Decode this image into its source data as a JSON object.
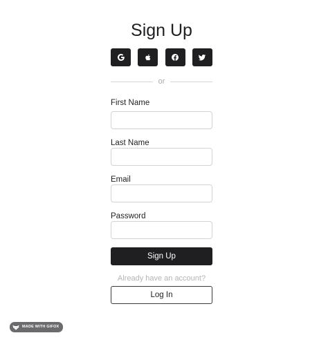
{
  "page": {
    "title": "Sign Up",
    "divider_text": "or"
  },
  "social": [
    {
      "name": "google",
      "icon": "google-icon"
    },
    {
      "name": "apple",
      "icon": "apple-icon"
    },
    {
      "name": "facebook",
      "icon": "facebook-icon"
    },
    {
      "name": "twitter",
      "icon": "twitter-icon"
    }
  ],
  "fields": {
    "first_name": {
      "label": "First Name",
      "value": "",
      "placeholder": ""
    },
    "last_name": {
      "label": "Last Name",
      "value": "",
      "placeholder": ""
    },
    "email": {
      "label": "Email",
      "value": "",
      "placeholder": ""
    },
    "password": {
      "label": "Password",
      "value": "",
      "placeholder": ""
    }
  },
  "actions": {
    "signup_label": "Sign Up",
    "account_prompt": "Already have an account?",
    "login_label": "Log In"
  },
  "watermark": {
    "text": "MADE WITH GIFOX"
  },
  "colors": {
    "primary": "#1f1f22",
    "muted_text": "#b5b5b8",
    "input_border": "#d3d3d6",
    "background": "#ffffff"
  }
}
